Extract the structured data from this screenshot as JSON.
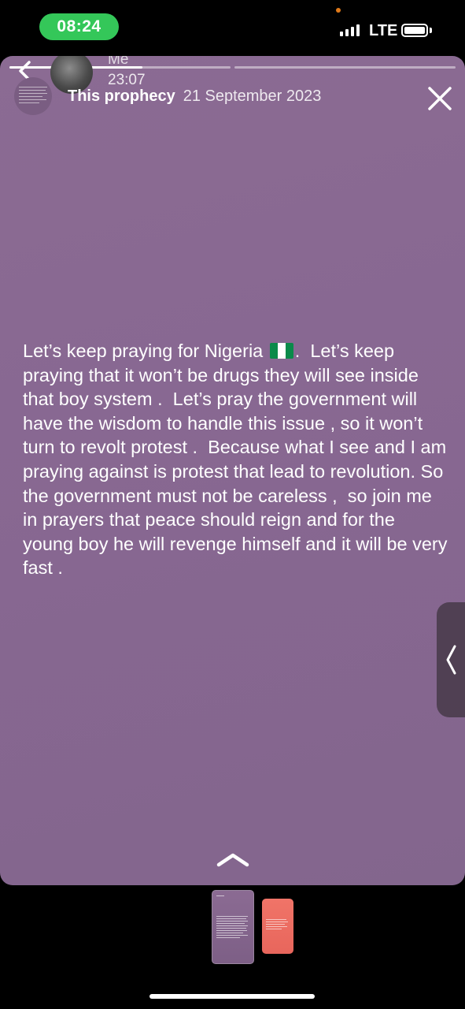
{
  "status_bar": {
    "time": "08:24",
    "network": "LTE",
    "icons": [
      "signal-icon",
      "battery-icon"
    ]
  },
  "story": {
    "author": "Me",
    "posted_time": "23:07",
    "subtitle_name": "This prophecy",
    "subtitle_date": "21 September 2023",
    "progress": {
      "segments": 2,
      "current": 1,
      "current_fraction": 0.6
    },
    "text_before_flag": "Let’s keep praying for Nigeria ",
    "flag_icon": "nigeria-flag-icon",
    "text_after_flag": ".  Let’s keep praying that it won’t be drugs they will see inside that boy system .  Let’s pray the government will\nhave the wisdom to handle this issue , so it won’t turn to revolt protest .  Because what I see and I am praying against is protest that lead to revolution. So the government must not be careless ,  so join me in prayers that peace should reign and for the young boy he will revenge himself and it will be very fast .",
    "background_color": "#876791",
    "icons": [
      "back-icon",
      "close-icon",
      "chevron-left-icon",
      "chevron-up-icon"
    ]
  },
  "thumbnails": [
    {
      "color": "#8b6b93",
      "selected": true
    },
    {
      "color": "#ee6e62",
      "selected": false
    }
  ]
}
